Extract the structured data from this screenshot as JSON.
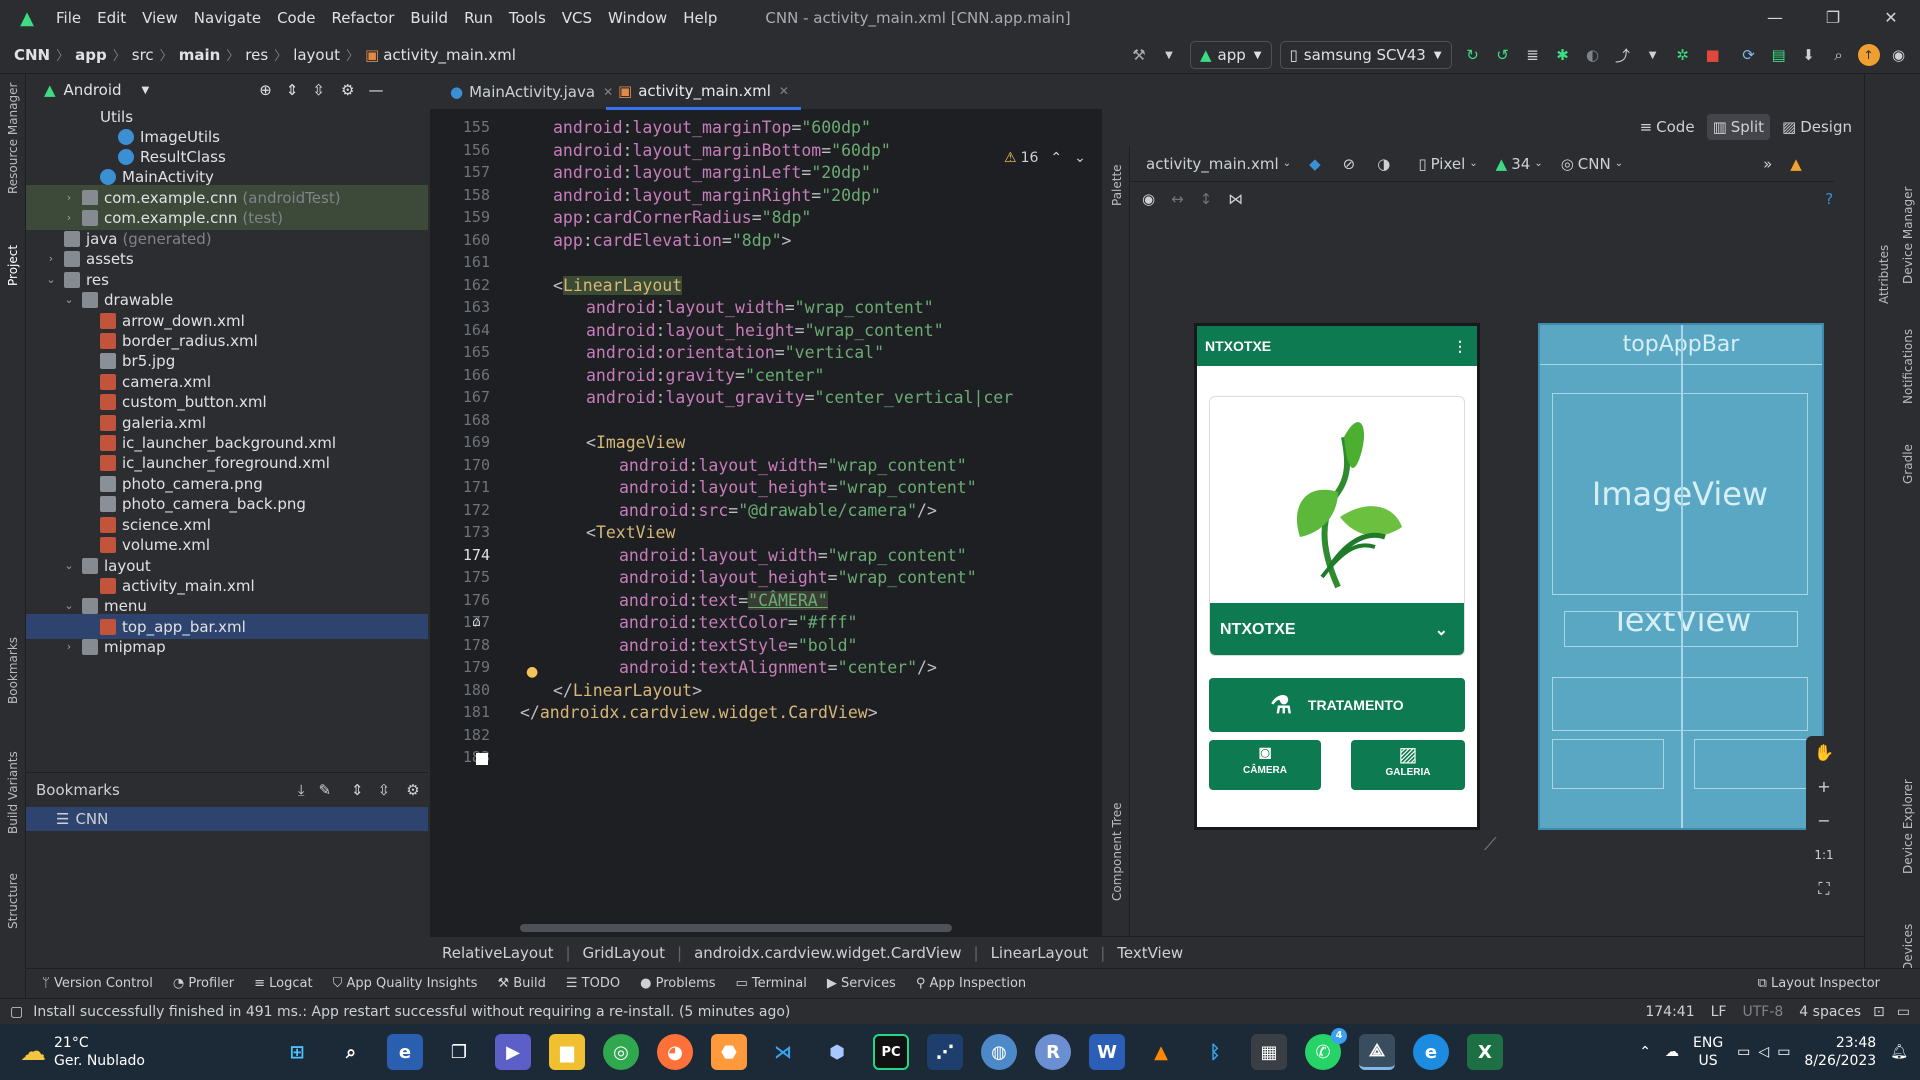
{
  "titlebar": {
    "menus": [
      "File",
      "Edit",
      "View",
      "Navigate",
      "Code",
      "Refactor",
      "Build",
      "Run",
      "Tools",
      "VCS",
      "Window",
      "Help"
    ],
    "window_title": "CNN - activity_main.xml [CNN.app.main]"
  },
  "navbar": {
    "crumbs": [
      "CNN",
      "app",
      "src",
      "main",
      "res",
      "layout",
      "activity_main.xml"
    ],
    "config": "app",
    "device": "samsung SCV43"
  },
  "project": {
    "view": "Android",
    "tree": [
      {
        "label": "Utils",
        "depth": 4
      },
      {
        "label": "ImageUtils",
        "depth": 5,
        "icon": "cls"
      },
      {
        "label": "ResultClass",
        "depth": 5,
        "icon": "cls"
      },
      {
        "label": "MainActivity",
        "depth": 4,
        "icon": "cls"
      },
      {
        "label": "com.example.cnn",
        "suffix": "(androidTest)",
        "depth": 3,
        "icon": "folder"
      },
      {
        "label": "com.example.cnn",
        "suffix": "(test)",
        "depth": 3,
        "icon": "folder"
      },
      {
        "label": "java",
        "suffix": "(generated)",
        "depth": 2,
        "icon": "folder"
      },
      {
        "label": "assets",
        "depth": 2,
        "icon": "folder"
      },
      {
        "label": "res",
        "depth": 2,
        "icon": "folder"
      },
      {
        "label": "drawable",
        "depth": 3,
        "icon": "folder"
      },
      {
        "label": "arrow_down.xml",
        "depth": 4,
        "icon": "xml"
      },
      {
        "label": "border_radius.xml",
        "depth": 4,
        "icon": "xml"
      },
      {
        "label": "br5.jpg",
        "depth": 4,
        "icon": "png"
      },
      {
        "label": "camera.xml",
        "depth": 4,
        "icon": "xml"
      },
      {
        "label": "custom_button.xml",
        "depth": 4,
        "icon": "xml"
      },
      {
        "label": "galeria.xml",
        "depth": 4,
        "icon": "xml"
      },
      {
        "label": "ic_launcher_background.xml",
        "depth": 4,
        "icon": "xml"
      },
      {
        "label": "ic_launcher_foreground.xml",
        "depth": 4,
        "icon": "xml"
      },
      {
        "label": "photo_camera.png",
        "depth": 4,
        "icon": "png"
      },
      {
        "label": "photo_camera_back.png",
        "depth": 4,
        "icon": "png"
      },
      {
        "label": "science.xml",
        "depth": 4,
        "icon": "xml"
      },
      {
        "label": "volume.xml",
        "depth": 4,
        "icon": "xml"
      },
      {
        "label": "layout",
        "depth": 3,
        "icon": "folder"
      },
      {
        "label": "activity_main.xml",
        "depth": 4,
        "icon": "xml"
      },
      {
        "label": "menu",
        "depth": 3,
        "icon": "folder"
      },
      {
        "label": "top_app_bar.xml",
        "depth": 4,
        "icon": "xml"
      },
      {
        "label": "mipmap",
        "depth": 3,
        "icon": "folder"
      }
    ]
  },
  "bookmarks": {
    "title": "Bookmarks",
    "item": "CNN"
  },
  "tabs": [
    {
      "label": "MainActivity.java"
    },
    {
      "label": "activity_main.xml"
    }
  ],
  "editor": {
    "warnings": "16",
    "lines": [
      {
        "n": "155",
        "indent": 1,
        "kind": "attr",
        "ns": "android",
        "name": "layout_marginTop",
        "val": "\"600dp\""
      },
      {
        "n": "156",
        "indent": 1,
        "kind": "attr",
        "ns": "android",
        "name": "layout_marginBottom",
        "val": "\"60dp\""
      },
      {
        "n": "157",
        "indent": 1,
        "kind": "attr",
        "ns": "android",
        "name": "layout_marginLeft",
        "val": "\"20dp\""
      },
      {
        "n": "158",
        "indent": 1,
        "kind": "attr",
        "ns": "android",
        "name": "layout_marginRight",
        "val": "\"20dp\""
      },
      {
        "n": "159",
        "indent": 1,
        "kind": "attr",
        "ns": "app",
        "name": "cardCornerRadius",
        "val": "\"8dp\""
      },
      {
        "n": "160",
        "indent": 1,
        "kind": "attr",
        "ns": "app",
        "name": "cardElevation",
        "val": "\"8dp\"",
        "end": ">"
      },
      {
        "n": "161",
        "indent": 0,
        "kind": "blank"
      },
      {
        "n": "162",
        "indent": 1,
        "kind": "tag",
        "tag": "LinearLayout"
      },
      {
        "n": "163",
        "indent": 2,
        "kind": "attr",
        "ns": "android",
        "name": "layout_width",
        "val": "\"wrap_content\""
      },
      {
        "n": "164",
        "indent": 2,
        "kind": "attr",
        "ns": "android",
        "name": "layout_height",
        "val": "\"wrap_content\""
      },
      {
        "n": "165",
        "indent": 2,
        "kind": "attr",
        "ns": "android",
        "name": "orientation",
        "val": "\"vertical\""
      },
      {
        "n": "166",
        "indent": 2,
        "kind": "attr",
        "ns": "android",
        "name": "gravity",
        "val": "\"center\""
      },
      {
        "n": "167",
        "indent": 2,
        "kind": "attr",
        "ns": "android",
        "name": "layout_gravity",
        "val": "\"center_vertical|cer"
      },
      {
        "n": "168",
        "indent": 0,
        "kind": "blank"
      },
      {
        "n": "169",
        "indent": 2,
        "kind": "tag",
        "tag": "ImageView"
      },
      {
        "n": "170",
        "indent": 3,
        "kind": "attr",
        "ns": "android",
        "name": "layout_width",
        "val": "\"wrap_content\""
      },
      {
        "n": "171",
        "indent": 3,
        "kind": "attr",
        "ns": "android",
        "name": "layout_height",
        "val": "\"wrap_content\""
      },
      {
        "n": "172",
        "indent": 3,
        "kind": "attr",
        "ns": "android",
        "name": "src",
        "val": "\"@drawable/camera\"",
        "end": "/>"
      },
      {
        "n": "173",
        "indent": 2,
        "kind": "tag",
        "tag": "TextView"
      },
      {
        "n": "174",
        "indent": 3,
        "kind": "attr",
        "ns": "android",
        "name": "layout_width",
        "val": "\"wrap_content\""
      },
      {
        "n": "175",
        "indent": 3,
        "kind": "attr",
        "ns": "android",
        "name": "layout_height",
        "val": "\"wrap_content\""
      },
      {
        "n": "176",
        "indent": 3,
        "kind": "attr",
        "ns": "android",
        "name": "text",
        "val": "\"CÂMERA\""
      },
      {
        "n": "177",
        "indent": 3,
        "kind": "attr",
        "ns": "android",
        "name": "textColor",
        "val": "\"#fff\""
      },
      {
        "n": "178",
        "indent": 3,
        "kind": "attr",
        "ns": "android",
        "name": "textStyle",
        "val": "\"bold\""
      },
      {
        "n": "179",
        "indent": 3,
        "kind": "attr",
        "ns": "android",
        "name": "textAlignment",
        "val": "\"center\"",
        "end": "/>"
      },
      {
        "n": "180",
        "indent": 1,
        "kind": "close",
        "tag": "LinearLayout"
      },
      {
        "n": "181",
        "indent": 0,
        "kind": "close",
        "tag": "androidx.cardview.widget.CardView"
      },
      {
        "n": "182",
        "indent": 0,
        "kind": "blank"
      },
      {
        "n": "183",
        "indent": 0,
        "kind": "blank"
      }
    ]
  },
  "design": {
    "view_modes": [
      "Code",
      "Split",
      "Design"
    ],
    "file": "activity_main.xml",
    "device": "Pixel",
    "api": "34",
    "theme": "CNN",
    "palette_label": "Palette",
    "component_tree_label": "Component Tree",
    "zoom_label": "1:1",
    "phone": {
      "app_title": "NTXOTXE",
      "dropdown_value": "NTXOTXE",
      "treat_button": "TRATAMENTO",
      "camera_button": "CÂMERA",
      "gallery_button": "GALERIA"
    },
    "blueprint": {
      "topbar": "topAppBar",
      "image": "ImageView",
      "text": "TextView"
    }
  },
  "breadcrumbs": [
    "RelativeLayout",
    "GridLayout",
    "androidx.cardview.widget.CardView",
    "LinearLayout",
    "TextView"
  ],
  "toolwindows": [
    "Version Control",
    "Profiler",
    "Logcat",
    "App Quality Insights",
    "Build",
    "TODO",
    "Problems",
    "Terminal",
    "Services",
    "App Inspection"
  ],
  "toolwindow_right": "Layout Inspector",
  "status": {
    "message": "Install successfully finished in 491 ms.: App restart successful without requiring a re-install. (5 minutes ago)",
    "position": "174:41",
    "line_sep": "LF",
    "encoding": "UTF-8",
    "indent": "4 spaces"
  },
  "side_tools_left": [
    "Resource Manager",
    "Project",
    "Bookmarks",
    "Build Variants",
    "Structure"
  ],
  "side_tools_right": [
    "Device Manager",
    "Notifications",
    "Gradle",
    "Device Explorer",
    "Running Devices"
  ],
  "attributes_label": "Attributes",
  "taskbar": {
    "weather_temp": "21°C",
    "weather_desc": "Ger. Nublado",
    "lang1": "ENG",
    "lang2": "US",
    "time": "23:48",
    "date": "8/26/2023",
    "whatsapp_badge": "4"
  },
  "colors": {
    "accent": "#3574f0",
    "app_green": "#0e7a52",
    "blueprint": "#5aa7c4"
  }
}
